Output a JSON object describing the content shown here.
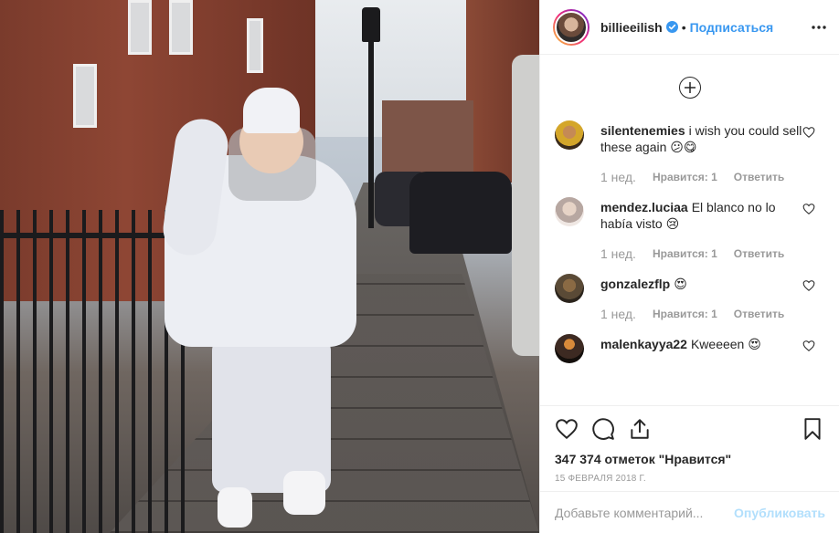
{
  "header": {
    "username": "billieeilish",
    "separator": "•",
    "follow_label": "Подписаться"
  },
  "comments": [
    {
      "username": "silentenemies",
      "text": "i wish you could sell these again 😕😋",
      "time": "1 нед.",
      "likes_label": "Нравится: 1",
      "reply_label": "Ответить",
      "avatar_color": "#d4a62a"
    },
    {
      "username": "mendez.luciaa",
      "text": "El blanco no lo había visto 😢",
      "time": "1 нед.",
      "likes_label": "Нравится: 1",
      "reply_label": "Ответить",
      "avatar_color": "#c9c2bf"
    },
    {
      "username": "gonzalezflp",
      "text": "😍",
      "time": "1 нед.",
      "likes_label": "Нравится: 1",
      "reply_label": "Ответить",
      "avatar_color": "#5a4a36"
    },
    {
      "username": "malenkayya22",
      "text": "Kweeeen 😍",
      "avatar_color": "#3d2a22"
    }
  ],
  "actions": {
    "like_icon": "heart-icon",
    "comment_icon": "comment-icon",
    "share_icon": "share-icon",
    "save_icon": "bookmark-icon",
    "likes_text": "347 374 отметок \"Нравится\"",
    "date": "15 февраля 2018 г."
  },
  "comment_box": {
    "placeholder": "Добавьте комментарий...",
    "publish_label": "Опубликовать"
  },
  "colors": {
    "accent": "#3897f0",
    "publish_disabled": "#b2dffc",
    "muted": "#999999"
  }
}
